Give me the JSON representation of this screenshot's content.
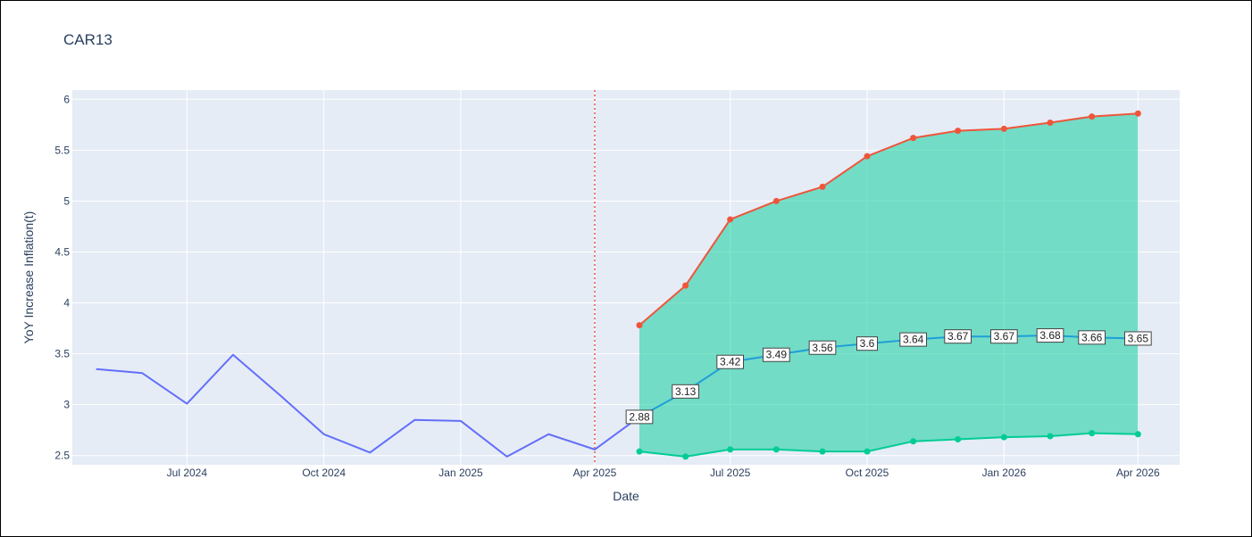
{
  "chart_data": {
    "type": "line",
    "title": "CAR13",
    "xlabel": "Date",
    "ylabel": "YoY Increase Inflation(t)",
    "ylim": [
      2.41,
      6.09
    ],
    "xlim": [
      "2024-04-15",
      "2026-04-29"
    ],
    "yticks": [
      2.5,
      3,
      3.5,
      4,
      4.5,
      5,
      5.5,
      6
    ],
    "ytick_labels": [
      "2.5",
      "3",
      "3.5",
      "4",
      "4.5",
      "5",
      "5.5",
      "6"
    ],
    "xticks": [
      "2024-07-01",
      "2024-10-01",
      "2025-01-01",
      "2025-04-01",
      "2025-07-01",
      "2025-10-01",
      "2026-01-01",
      "2026-04-01"
    ],
    "xtick_labels": [
      "Jul 2024",
      "Oct 2024",
      "Jan 2025",
      "Apr 2025",
      "Jul 2025",
      "Oct 2025",
      "Jan 2026",
      "Apr 2026"
    ],
    "grid": true,
    "vline": {
      "x": "2025-04-01",
      "color": "#ef553b",
      "style": "dotted"
    },
    "colors": {
      "plot_bg": "#e5ecf6",
      "grid": "#ffffff",
      "history": "#636efa",
      "forecast": "#1f9ed8",
      "upper": "#ef553b",
      "lower": "#00cc96",
      "band": "#00cc96"
    },
    "series": [
      {
        "role": "history",
        "x": [
          "2024-05-01",
          "2024-06-01",
          "2024-07-01",
          "2024-08-01",
          "2024-09-01",
          "2024-10-01",
          "2024-11-01",
          "2024-12-01",
          "2025-01-01",
          "2025-02-01",
          "2025-03-01",
          "2025-04-01",
          "2025-05-01"
        ],
        "values": [
          3.35,
          3.31,
          3.01,
          3.49,
          3.1,
          2.71,
          2.53,
          2.85,
          2.84,
          2.49,
          2.71,
          2.56,
          2.88
        ]
      },
      {
        "role": "forecast",
        "x": [
          "2025-05-01",
          "2025-06-01",
          "2025-07-01",
          "2025-08-01",
          "2025-09-01",
          "2025-10-01",
          "2025-11-01",
          "2025-12-01",
          "2026-01-01",
          "2026-02-01",
          "2026-03-01",
          "2026-04-01"
        ],
        "values": [
          2.88,
          3.13,
          3.42,
          3.49,
          3.56,
          3.6,
          3.64,
          3.67,
          3.67,
          3.68,
          3.66,
          3.65
        ],
        "labels": [
          "2.88",
          "3.13",
          "3.42",
          "3.49",
          "3.56",
          "3.6",
          "3.64",
          "3.67",
          "3.67",
          "3.68",
          "3.66",
          "3.65"
        ]
      },
      {
        "role": "upper",
        "x": [
          "2025-05-01",
          "2025-06-01",
          "2025-07-01",
          "2025-08-01",
          "2025-09-01",
          "2025-10-01",
          "2025-11-01",
          "2025-12-01",
          "2026-01-01",
          "2026-02-01",
          "2026-03-01",
          "2026-04-01"
        ],
        "values": [
          3.78,
          4.17,
          4.82,
          5.0,
          5.14,
          5.44,
          5.62,
          5.69,
          5.71,
          5.77,
          5.83,
          5.86
        ]
      },
      {
        "role": "lower",
        "x": [
          "2025-05-01",
          "2025-06-01",
          "2025-07-01",
          "2025-08-01",
          "2025-09-01",
          "2025-10-01",
          "2025-11-01",
          "2025-12-01",
          "2026-01-01",
          "2026-02-01",
          "2026-03-01",
          "2026-04-01"
        ],
        "values": [
          2.54,
          2.49,
          2.56,
          2.56,
          2.54,
          2.54,
          2.64,
          2.66,
          2.68,
          2.69,
          2.72,
          2.71
        ]
      }
    ]
  }
}
